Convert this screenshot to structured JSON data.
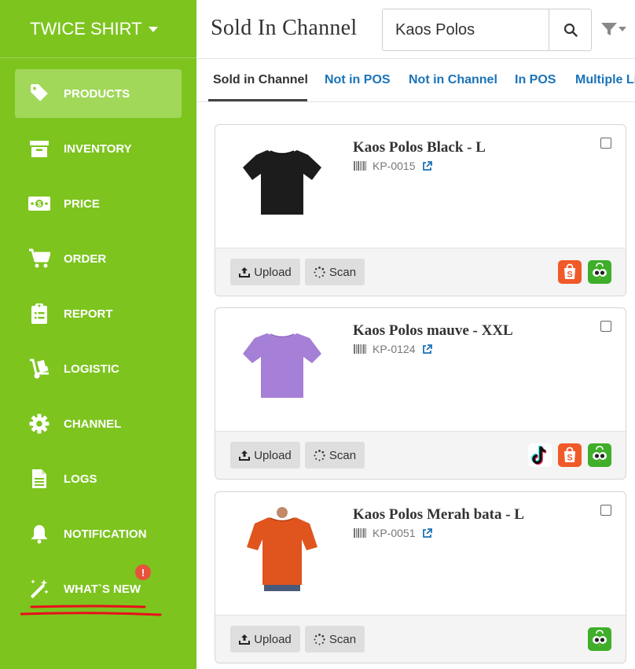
{
  "sidebar": {
    "brand": "TWICE SHIRT",
    "items": [
      {
        "label": "PRODUCTS",
        "icon": "tag-icon",
        "active": true
      },
      {
        "label": "INVENTORY",
        "icon": "archive-icon",
        "active": false
      },
      {
        "label": "PRICE",
        "icon": "money-icon",
        "active": false
      },
      {
        "label": "ORDER",
        "icon": "cart-icon",
        "active": false
      },
      {
        "label": "REPORT",
        "icon": "clipboard-icon",
        "active": false
      },
      {
        "label": "LOGISTIC",
        "icon": "dolly-icon",
        "active": false
      },
      {
        "label": "CHANNEL",
        "icon": "gear-icon",
        "active": false
      },
      {
        "label": "LOGS",
        "icon": "file-icon",
        "active": false
      },
      {
        "label": "NOTIFICATION",
        "icon": "bell-icon",
        "active": false
      },
      {
        "label": "WHAT`S NEW",
        "icon": "magic-wand-icon",
        "active": false,
        "badge": "!"
      }
    ]
  },
  "header": {
    "title": "Sold In Channel",
    "search": {
      "value": "Kaos Polos",
      "placeholder": ""
    }
  },
  "tabs": [
    {
      "label": "Sold in Channel",
      "active": true
    },
    {
      "label": "Not in POS",
      "active": false
    },
    {
      "label": "Not in Channel",
      "active": false
    },
    {
      "label": "In POS",
      "active": false
    },
    {
      "label": "Multiple Li",
      "active": false
    }
  ],
  "products": [
    {
      "name": "Kaos Polos Black - L",
      "sku": "KP-0015",
      "color": "#1c1c1c",
      "channels": [
        "shopee",
        "tokopedia"
      ]
    },
    {
      "name": "Kaos Polos mauve - XXL",
      "sku": "KP-0124",
      "color": "#a67fd6",
      "channels": [
        "tiktok",
        "shopee",
        "tokopedia"
      ]
    },
    {
      "name": "Kaos Polos Merah bata - L",
      "sku": "KP-0051",
      "color": "#e0541e",
      "channels": [
        "tokopedia"
      ]
    }
  ],
  "buttons": {
    "upload": "Upload",
    "scan": "Scan"
  },
  "colors": {
    "sidebar": "#7dc41f",
    "active_item": "#a1d85a",
    "tab_link": "#1a73b8",
    "badge": "#e8523b",
    "annotation": "#e8101a"
  }
}
